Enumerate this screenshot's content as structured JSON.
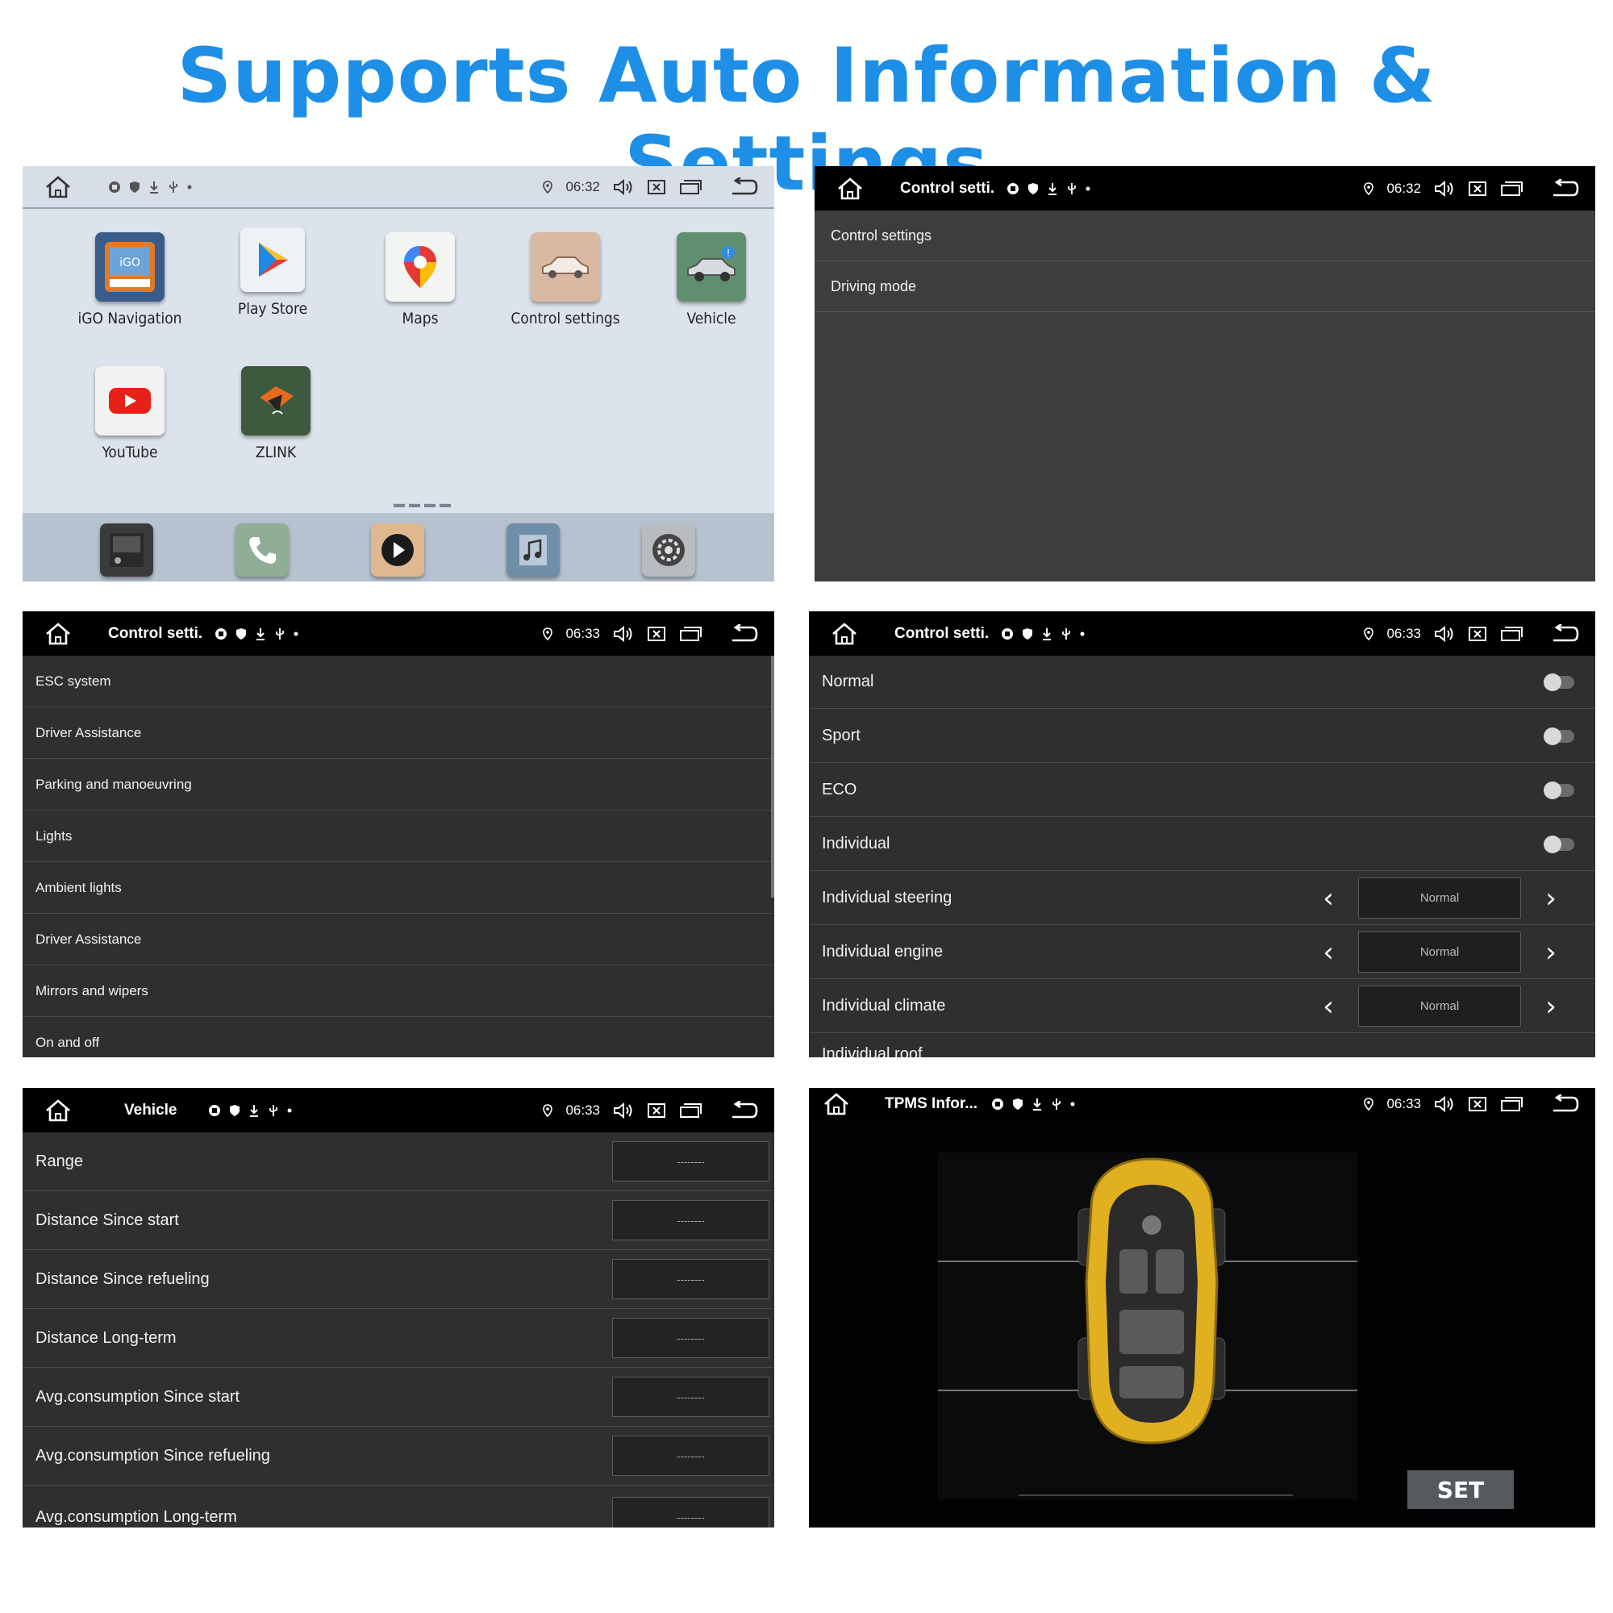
{
  "headline": "Supports Auto Information & Settings",
  "panel1": {
    "time": "06:32",
    "apps": [
      {
        "label": "iGO Navigation",
        "icon": "igo-icon"
      },
      {
        "label": "Play Store",
        "icon": "play-store-icon"
      },
      {
        "label": "Maps",
        "icon": "maps-icon"
      },
      {
        "label": "Control settings",
        "icon": "car-icon"
      },
      {
        "label": "Vehicle",
        "icon": "vehicle-icon"
      },
      {
        "label": "YouTube",
        "icon": "youtube-icon"
      },
      {
        "label": "ZLINK",
        "icon": "zlink-icon"
      }
    ],
    "dock": [
      "radio-icon",
      "phone-icon",
      "video-player-icon",
      "music-icon",
      "settings-icon"
    ]
  },
  "panel2": {
    "title": "Control setti...",
    "time": "06:32",
    "rows": [
      "Control settings",
      "Driving mode"
    ]
  },
  "panel3": {
    "title": "Control setti...",
    "time": "06:33",
    "rows": [
      "ESC system",
      "Driver Assistance",
      "Parking and manoeuvring",
      "Lights",
      "Ambient lights",
      "Driver Assistance",
      "Mirrors and wipers",
      "On and off"
    ]
  },
  "panel4": {
    "title": "Control setti...",
    "time": "06:33",
    "toggles": [
      "Normal",
      "Sport",
      "ECO",
      "Individual"
    ],
    "selectors": [
      {
        "label": "Individual steering",
        "value": "Normal"
      },
      {
        "label": "Individual engine",
        "value": "Normal"
      },
      {
        "label": "Individual climate",
        "value": "Normal"
      }
    ],
    "partial_row": "Individual roof"
  },
  "panel5": {
    "title": "Vehicle",
    "time": "06:33",
    "rows": [
      {
        "label": "Range",
        "value": "--------"
      },
      {
        "label": "Distance Since start",
        "value": "--------"
      },
      {
        "label": "Distance Since refueling",
        "value": "--------"
      },
      {
        "label": "Distance Long-term",
        "value": "--------"
      },
      {
        "label": "Avg.consumption Since start",
        "value": "--------"
      },
      {
        "label": "Avg.consumption Since refueling",
        "value": "--------"
      },
      {
        "label": "Avg.consumption Long-term",
        "value": "--------"
      }
    ]
  },
  "panel6": {
    "title": "TPMS Infor...",
    "time": "06:33",
    "set_label": "SET"
  },
  "colors": {
    "accent": "#1e8fe6",
    "dark_bg": "#2f2f2f",
    "status_bar": "#000000"
  }
}
